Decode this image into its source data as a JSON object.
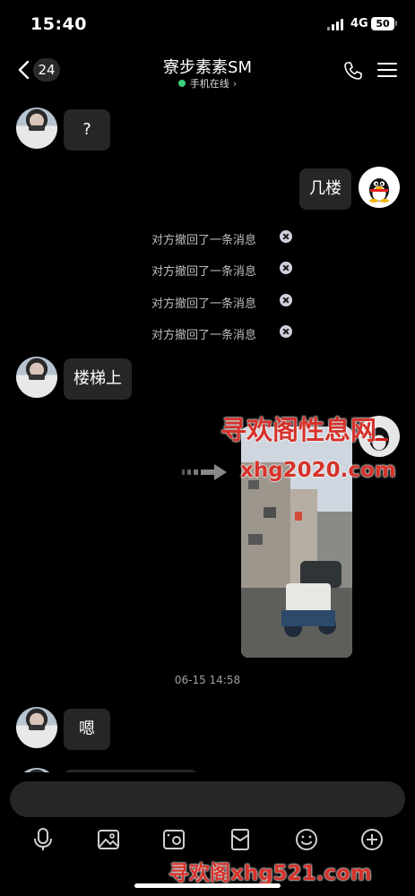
{
  "status_bar": {
    "time": "15:40",
    "network": "4G",
    "battery": "50"
  },
  "header": {
    "unread_count": "24",
    "contact_name": "寮步素素SM",
    "online_status": "手机在线",
    "icons": [
      "back-icon",
      "phone-icon",
      "menu-icon"
    ]
  },
  "messages": {
    "m1": "?",
    "m2": "几楼",
    "recalled": [
      "对方撤回了一条消息",
      "对方撤回了一条消息",
      "对方撤回了一条消息",
      "对方撤回了一条消息"
    ],
    "m3": "楼梯上",
    "timestamp": "06-15 14:58",
    "m4": "嗯"
  },
  "watermarks": {
    "main": "寻欢阁性息网",
    "url": "xhg2020.com",
    "bottom": "寻欢阁xhg521.com"
  },
  "toolbar": {
    "icons": [
      "microphone-icon",
      "image-icon",
      "camera-icon",
      "red-packet-icon",
      "emoji-icon",
      "plus-icon"
    ]
  },
  "colors": {
    "background": "#000000",
    "bubble": "#262626",
    "online": "#3ad07a",
    "watermark": "#d6322b"
  }
}
